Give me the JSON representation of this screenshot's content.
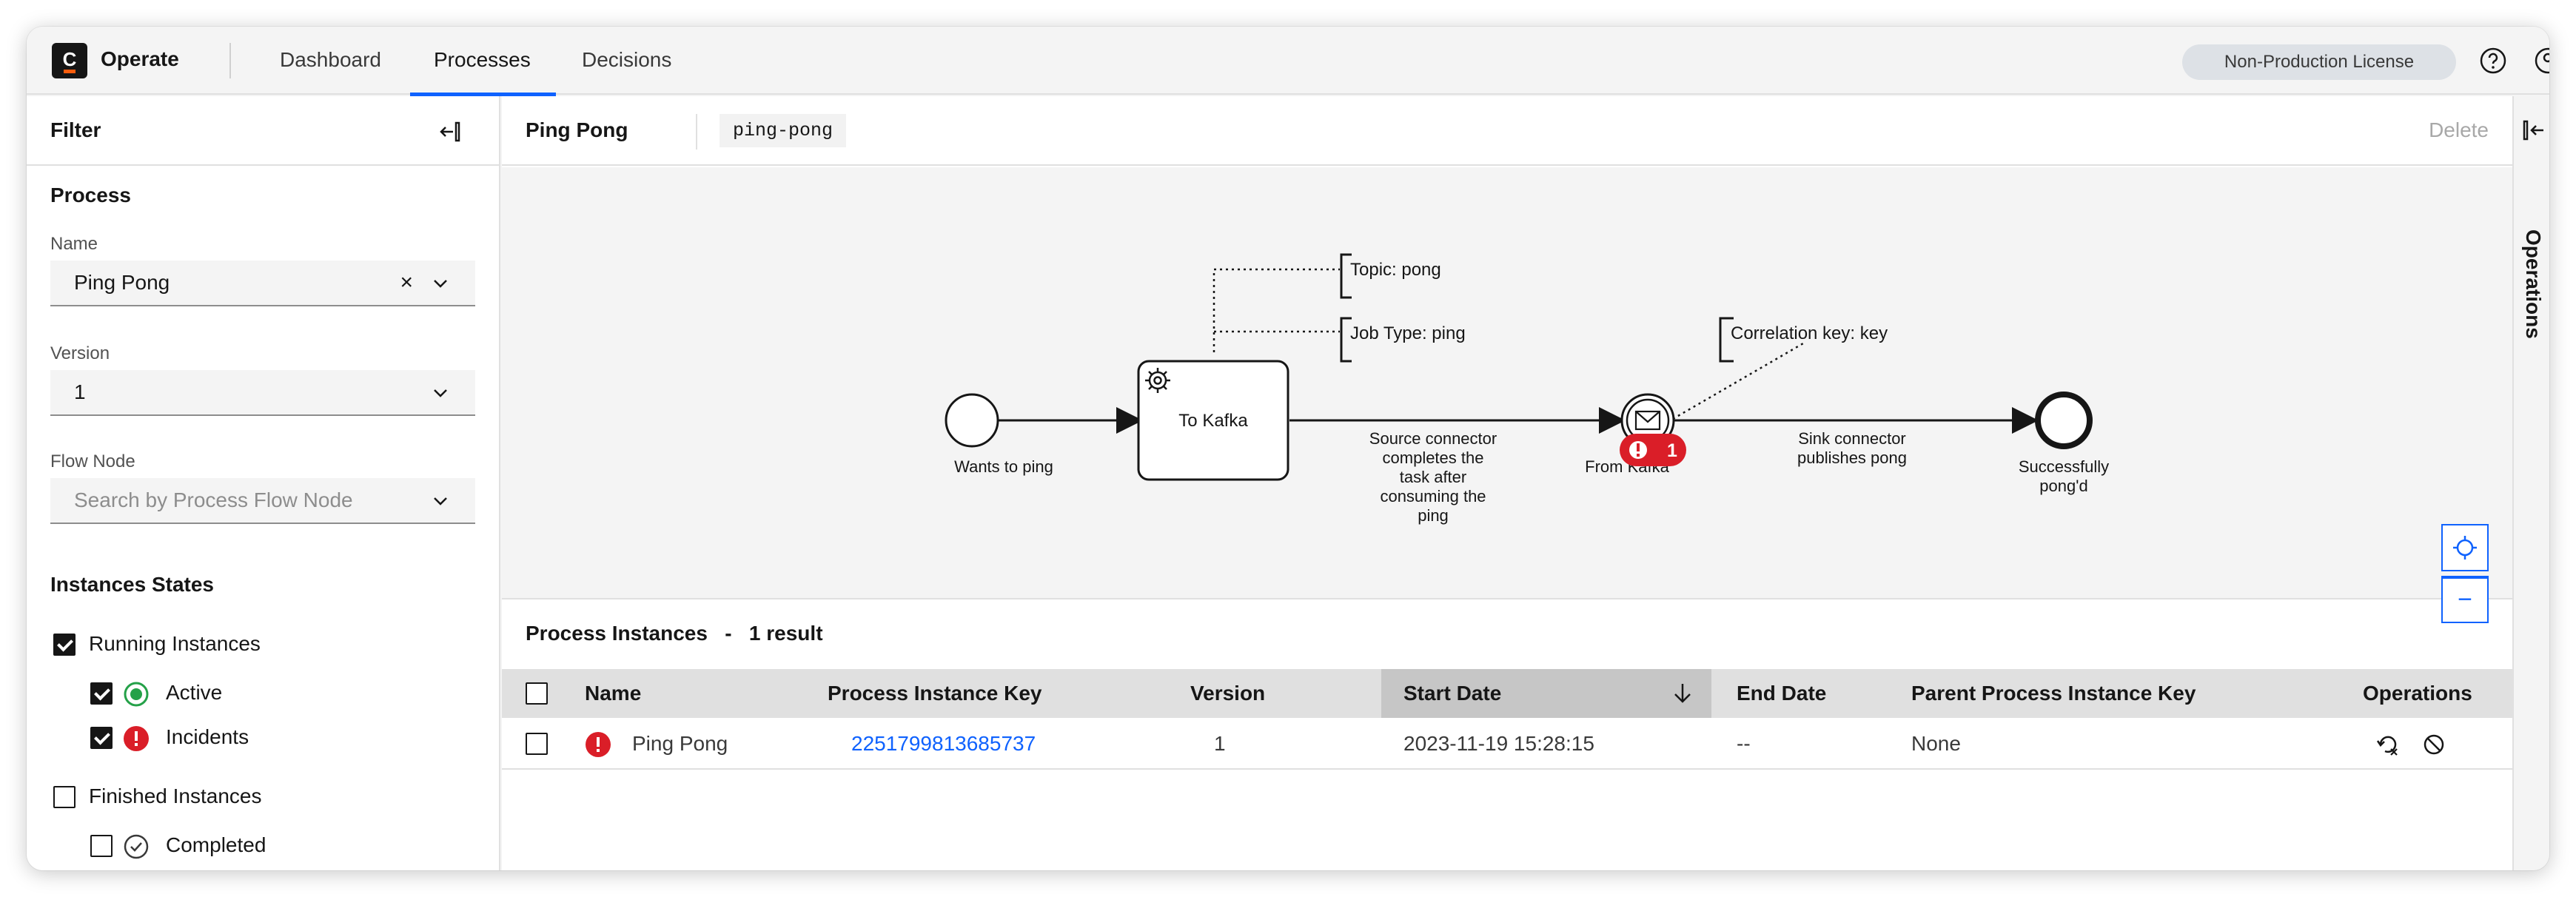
{
  "header": {
    "logo_letter": "C",
    "app_name": "Operate",
    "nav": [
      "Dashboard",
      "Processes",
      "Decisions"
    ],
    "active_nav": "Processes",
    "license": "Non-Production License",
    "icons": [
      "help-icon",
      "user-icon"
    ]
  },
  "filter": {
    "title": "Filter",
    "process_section": "Process",
    "name_label": "Name",
    "name_value": "Ping Pong",
    "clear_glyph": "×",
    "version_label": "Version",
    "version_value": "1",
    "flow_node_label": "Flow Node",
    "flow_node_placeholder": "Search by Process Flow Node",
    "states_section": "Instances States",
    "running": "Running Instances",
    "active": "Active",
    "incidents": "Incidents",
    "finished": "Finished Instances",
    "completed": "Completed"
  },
  "process": {
    "title": "Ping Pong",
    "id": "ping-pong",
    "delete_label": "Delete"
  },
  "diagram": {
    "start_event": "Wants to ping",
    "task": "To Kafka",
    "topic_annotation": "Topic: pong",
    "job_type_annotation": "Job Type: ping",
    "correlation_annotation": "Correlation key: key",
    "flow_label_1": [
      "Source connector",
      "completes the",
      "task after",
      "consuming the",
      "ping"
    ],
    "catch_event": "From Kafka",
    "incident_count": "1",
    "flow_label_2": [
      "Sink connector",
      "publishes pong"
    ],
    "end_event": [
      "Successfully",
      "pong'd"
    ],
    "zoom_in": "+",
    "zoom_out": "−"
  },
  "instances": {
    "title": "Process Instances   -   1 result",
    "columns": [
      "Name",
      "Process Instance Key",
      "Version",
      "Start Date",
      "End Date",
      "Parent Process Instance Key",
      "Operations"
    ],
    "sorted_column": "Start Date",
    "rows": [
      {
        "name": "Ping Pong",
        "key": "2251799813685737",
        "version": "1",
        "start_date": "2023-11-19 15:28:15",
        "end_date": "--",
        "parent": "None"
      }
    ]
  },
  "operations_panel": {
    "label": "Operations"
  },
  "colors": {
    "accent": "#0f62fe",
    "incident": "#da1e28",
    "active": "#24a148"
  }
}
